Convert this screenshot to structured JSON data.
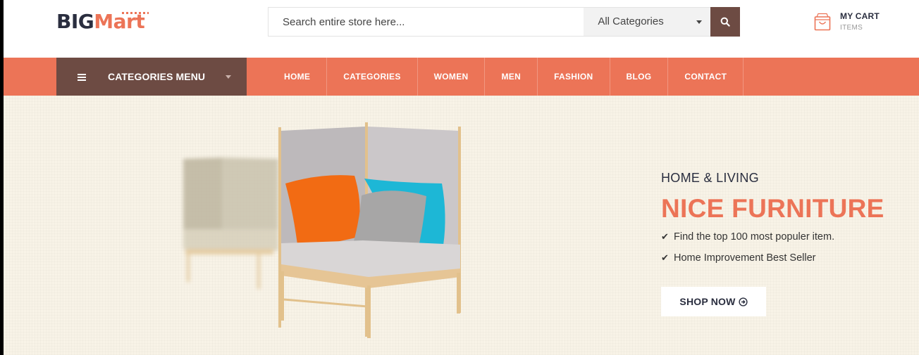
{
  "header": {
    "logo": {
      "part1": "BIG",
      "part2": "Mart"
    },
    "search": {
      "placeholder": "Search entire store here...",
      "value": ""
    },
    "category_select": {
      "selected": "All Categories"
    },
    "cart": {
      "title": "MY CART",
      "subtitle": "ITEMS"
    }
  },
  "nav": {
    "categories_menu_label": "CATEGORIES MENU",
    "links": [
      "HOME",
      "CATEGORIES",
      "WOMEN",
      "MEN",
      "FASHION",
      "BLOG",
      "CONTACT"
    ]
  },
  "hero": {
    "kicker": "HOME & LIVING",
    "headline": "NICE FURNITURE",
    "features": [
      "Find the top 100 most populer item.",
      "Home Improvement Best Seller"
    ],
    "cta_label": "SHOP NOW"
  },
  "colors": {
    "accent": "#ec7457",
    "brown": "#6d4b43",
    "dark_text": "#2a2e3f",
    "hero_bg": "#f8f3e7"
  },
  "icons": [
    "search-icon",
    "cart-bag-icon",
    "menu-icon",
    "chevron-down-icon",
    "check-icon",
    "arrow-circle-right-icon"
  ]
}
